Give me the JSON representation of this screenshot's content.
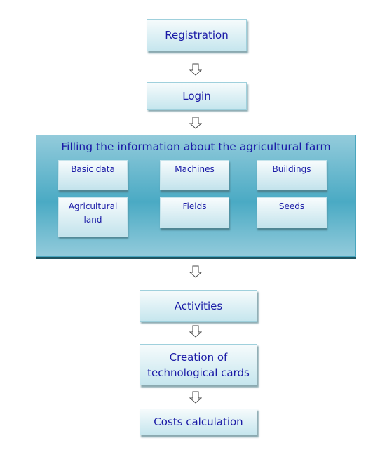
{
  "steps": {
    "registration": "Registration",
    "login": "Login",
    "activities": "Activities",
    "creation": "Creation of technological cards",
    "costs": "Costs calculation"
  },
  "farm_info": {
    "title": "Filling the information about the agricultural farm",
    "items": [
      "Basic data",
      "Machines",
      "Buildings",
      "Agricultural land",
      "Fields",
      "Seeds"
    ]
  },
  "colors": {
    "text": "#1a1aa6",
    "container": "#4aaac4",
    "box_border": "#9fd0dc"
  }
}
